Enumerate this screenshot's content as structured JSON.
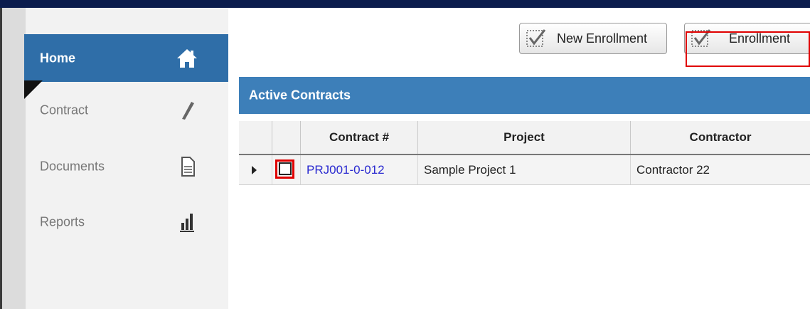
{
  "sidebar": {
    "items": [
      {
        "label": "Home",
        "icon": "home-icon",
        "active": true
      },
      {
        "label": "Contract",
        "icon": "pencil-icon",
        "active": false
      },
      {
        "label": "Documents",
        "icon": "document-icon",
        "active": false
      },
      {
        "label": "Reports",
        "icon": "bar-chart-icon",
        "active": false
      }
    ]
  },
  "toolbar": {
    "new_enrollment_label": "New Enrollment",
    "enrollment_label": "Enrollment"
  },
  "panel": {
    "title": "Active Contracts",
    "columns": [
      "Contract #",
      "Project",
      "Contractor"
    ],
    "rows": [
      {
        "contract": "PRJ001-0-012",
        "project": "Sample Project 1",
        "contractor": "Contractor 22"
      }
    ]
  },
  "colors": {
    "top_bar": "#0b1c4d",
    "nav_active": "#2f6ea8",
    "panel_header": "#3d7fb9",
    "highlight": "#e00000",
    "link": "#2a2ad0"
  }
}
